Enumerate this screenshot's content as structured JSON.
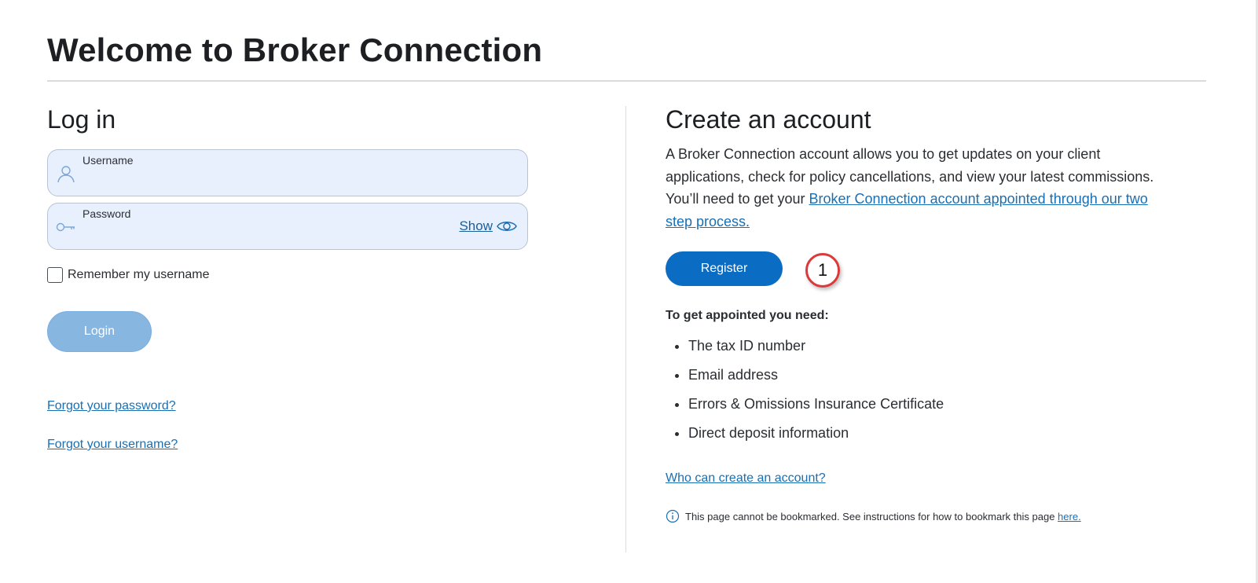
{
  "page": {
    "title": "Welcome to Broker Connection"
  },
  "login": {
    "heading": "Log in",
    "username_label": "Username",
    "username_value": "",
    "password_label": "Password",
    "password_value": "",
    "show_label": "Show",
    "remember_label": "Remember my username",
    "remember_checked": false,
    "login_button": "Login",
    "forgot_password": "Forgot your password?",
    "forgot_username": "Forgot your username?",
    "icons": {
      "username": "user-icon",
      "password": "key-icon",
      "show": "eye-icon"
    }
  },
  "create": {
    "heading": "Create an account",
    "intro_text": "A Broker Connection account allows you to get updates on your client applications, check for policy cancellations, and view your latest commissions. You’ll need to get your ",
    "intro_link": "Broker Connection account appointed through our two step process.",
    "register_button": "Register",
    "step_badge": "1",
    "requirements_title": "To get appointed you need:",
    "requirements": [
      "The tax ID number",
      "Email address",
      "Errors & Omissions Insurance Certificate",
      "Direct deposit information"
    ],
    "who_link": "Who can create an account?",
    "notice_text": "This page cannot be bookmarked. See instructions for how to bookmark this page ",
    "notice_link": "here."
  },
  "colors": {
    "accent": "#0a6cc2",
    "link": "#1a6fb3",
    "field_bg": "#e8f0fe",
    "login_disabled": "#87b6e0",
    "badge_border": "#dc3a3a"
  }
}
